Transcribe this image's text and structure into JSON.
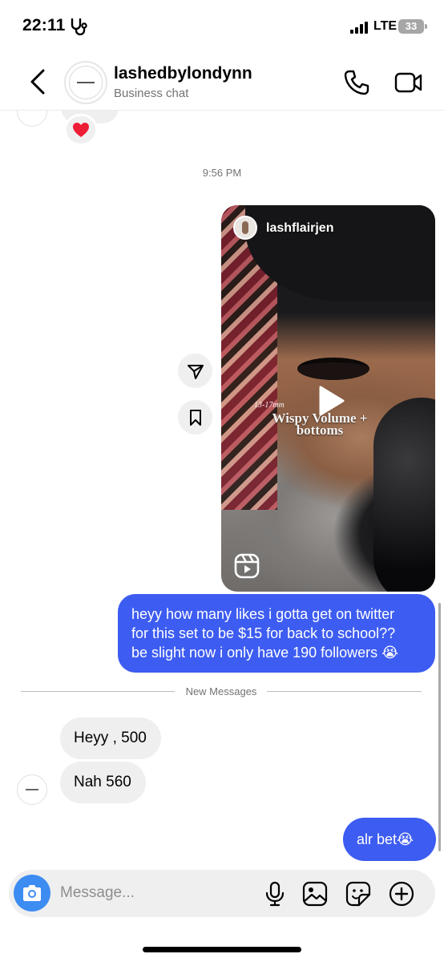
{
  "status_bar": {
    "time": "22:11",
    "network": "LTE",
    "battery": "33"
  },
  "header": {
    "name": "lashedbylondynn",
    "subtitle": "Business chat"
  },
  "thread": {
    "timestamp": "9:56 PM",
    "shared_reel": {
      "author": "lashflairjen",
      "caption_small": "13-17mm",
      "caption_line1": "Wispy Volume +",
      "caption_line2": "bottoms"
    },
    "sent_message_1": {
      "line1": "heyy how many likes i gotta get on twitter",
      "line2": "for this set to be $15 for back to school??",
      "line3": "be slight now i only have 190 followers 😭"
    },
    "divider": "New Messages",
    "received_messages": [
      "Heyy , 500",
      "Nah 560"
    ],
    "sent_message_2": "alr bet😭"
  },
  "composer": {
    "placeholder": "Message..."
  },
  "colors": {
    "outgoing_bubble": "#3d5cf1",
    "incoming_bubble": "#efefef",
    "camera_button": "#3d8cf2"
  },
  "icons": [
    "health-icon",
    "back-icon",
    "phone-icon",
    "video-call-icon",
    "heart-icon",
    "send-icon",
    "bookmark-icon",
    "play-icon",
    "reels-icon",
    "camera-icon",
    "microphone-icon",
    "gallery-icon",
    "sticker-icon",
    "add-icon"
  ]
}
